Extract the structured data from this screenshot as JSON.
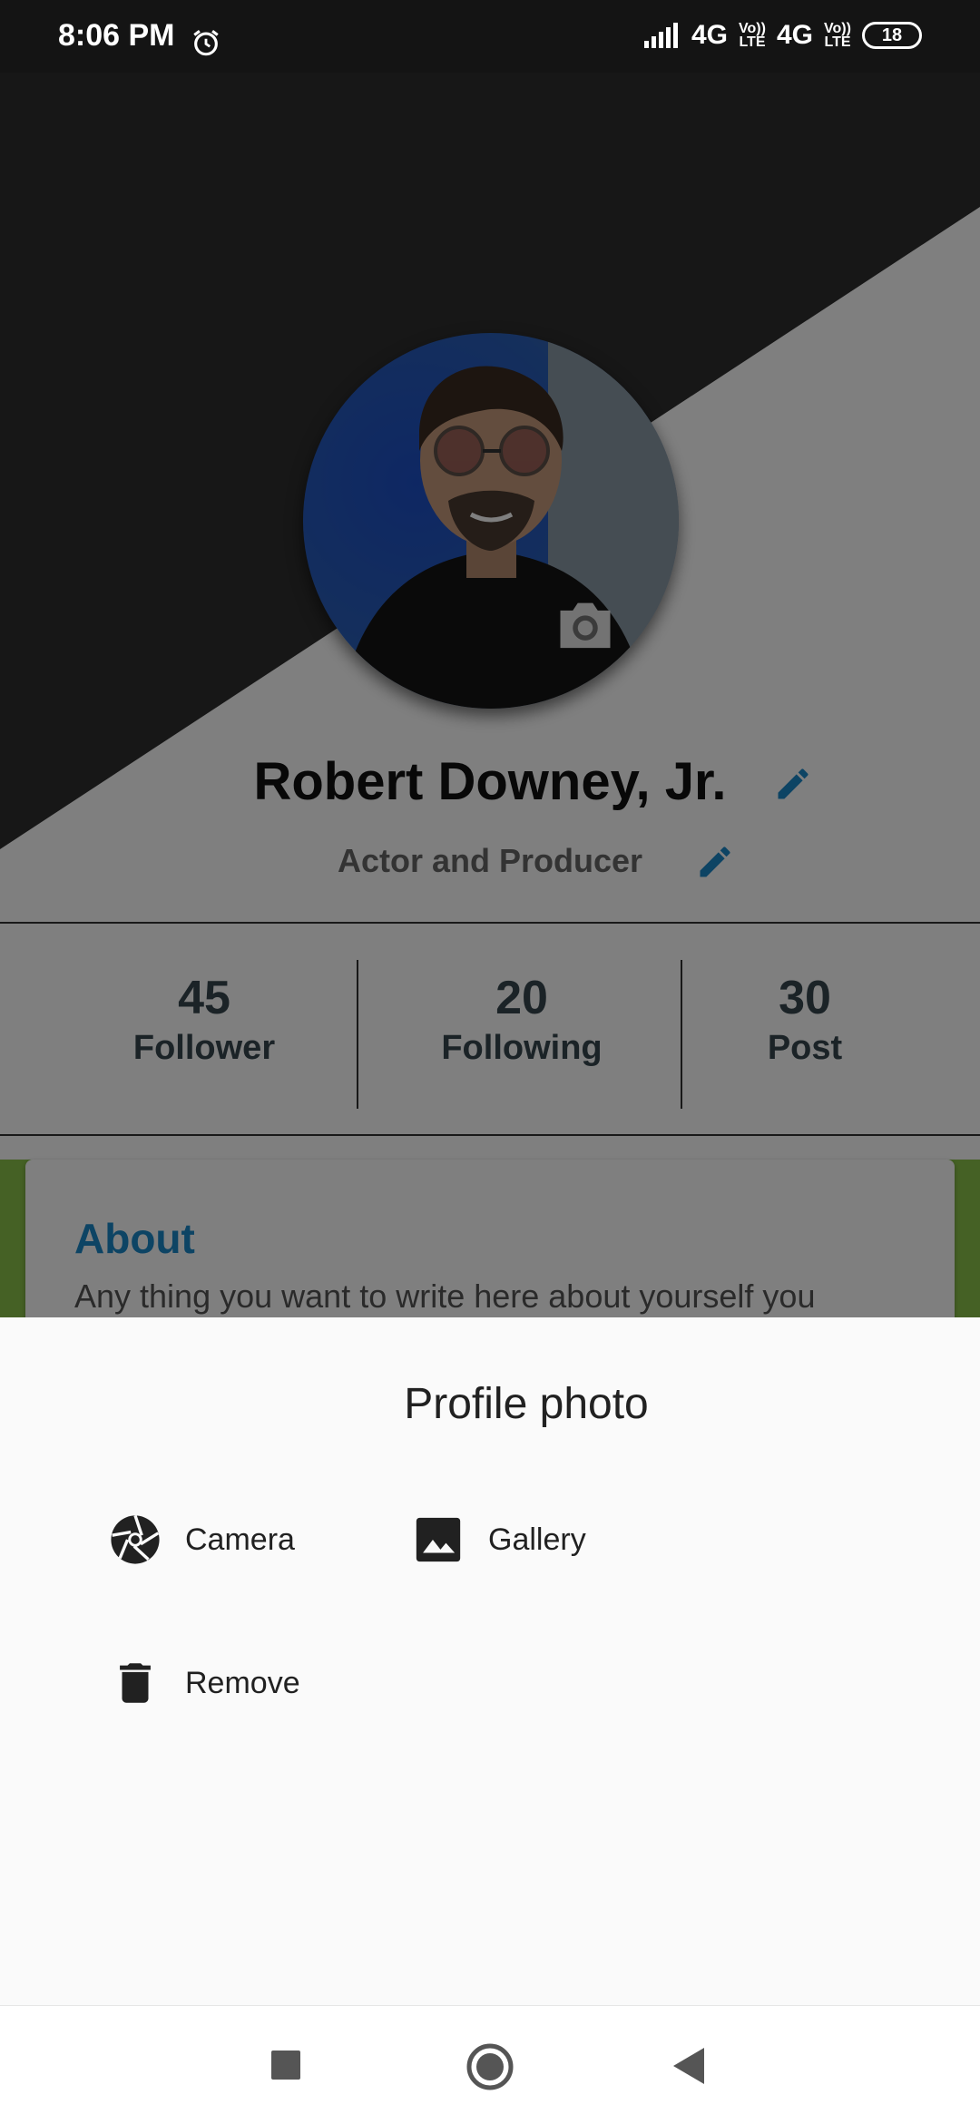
{
  "status_bar": {
    "time": "8:06 PM",
    "network_1": "4G",
    "volte_1": "Vo)) LTE",
    "network_2": "4G",
    "volte_2": "Vo)) LTE",
    "battery": "18"
  },
  "profile": {
    "name": "Robert Downey, Jr.",
    "subtitle": "Actor and Producer",
    "stats": [
      {
        "value": "45",
        "label": "Follower"
      },
      {
        "value": "20",
        "label": "Following"
      },
      {
        "value": "30",
        "label": "Post"
      }
    ],
    "about": {
      "title": "About",
      "text": "Any thing you want to write here about yourself you"
    }
  },
  "sheet": {
    "title": "Profile photo",
    "options": [
      {
        "label": "Camera",
        "icon": "camera-aperture-icon"
      },
      {
        "label": "Gallery",
        "icon": "image-icon"
      },
      {
        "label": "Remove",
        "icon": "trash-icon"
      }
    ]
  },
  "nav": {
    "icons": [
      "square-icon",
      "home-circle-icon",
      "back-triangle-icon"
    ]
  },
  "colors": {
    "accent": "#1a88c9",
    "green": "#8bc34a",
    "stats_text": "#37474f"
  }
}
